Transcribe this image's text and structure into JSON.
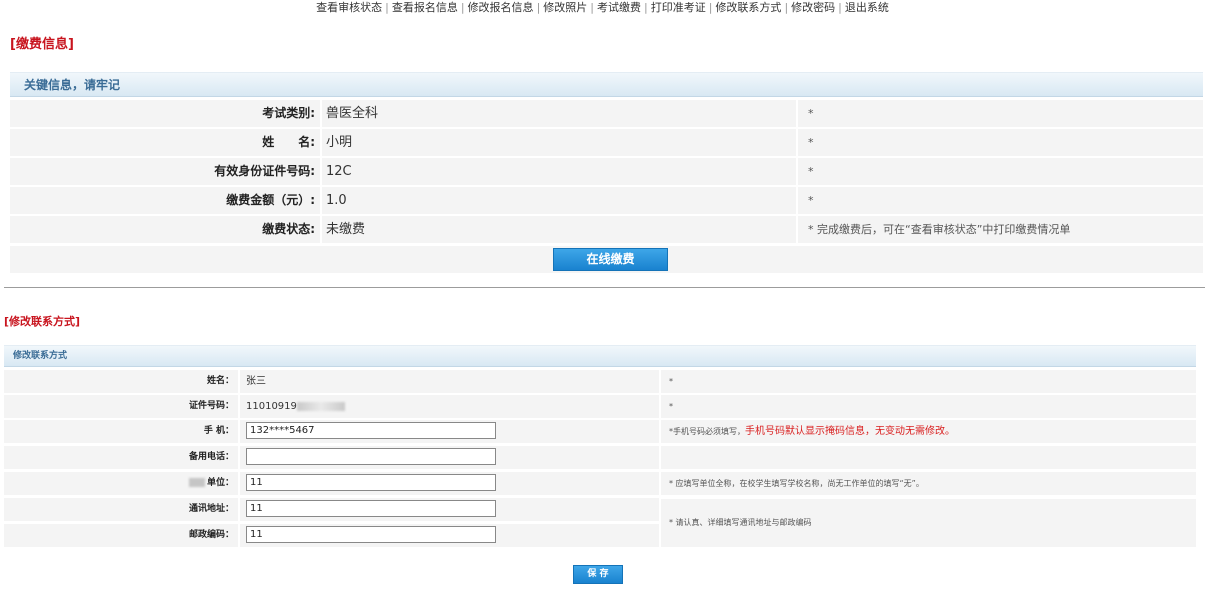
{
  "top_nav": [
    "查看审核状态",
    "查看报名信息",
    "修改报名信息",
    "修改照片",
    "考试缴费",
    "打印准考证",
    "修改联系方式",
    "修改密码",
    "退出系统"
  ],
  "payment": {
    "section_title": "[缴费信息]",
    "panel_title": "关键信息，请牢记",
    "rows": [
      {
        "label": "考试类别:",
        "value": "兽医全科",
        "note": "*"
      },
      {
        "label": "姓　　名:",
        "value": "小明",
        "note": "*"
      },
      {
        "label": "有效身份证件号码:",
        "value": "12C",
        "note": "*"
      },
      {
        "label": "缴费金额（元）:",
        "value": "1.0",
        "note": "*"
      },
      {
        "label": "缴费状态:",
        "value": "未缴费",
        "note": "* 完成缴费后，可在“查看审核状态”中打印缴费情况单"
      }
    ],
    "pay_button": "在线缴费"
  },
  "contact": {
    "section_title": "[修改联系方式]",
    "panel_title": "修改联系方式",
    "name": {
      "label": "姓名：",
      "value": "张三",
      "note": "*"
    },
    "id_number": {
      "label": "证件号码：",
      "value": "11010919",
      "note": "*"
    },
    "mobile": {
      "label": "手 机：",
      "value": "132****5467",
      "note_prefix": "*手机号码必须填写，",
      "note_warning": "手机号码默认显示掩码信息，无变动无需修改。"
    },
    "backup_phone": {
      "label": "备用电话：",
      "value": ""
    },
    "employer": {
      "label": "单位：",
      "value": "11",
      "note": "* 应填写单位全称，在校学生填写学校名称，尚无工作单位的填写“无”。"
    },
    "address": {
      "label": "通讯地址：",
      "value": "11"
    },
    "postcode": {
      "label": "邮政编码：",
      "value": "11"
    },
    "address_note": "* 请认真、详细填写通讯地址与邮政编码",
    "save_button": "保 存"
  },
  "colors": {
    "accent_red": "#c8141e",
    "button_blue": "#1982cf",
    "panel_header_text": "#3a6c96"
  }
}
